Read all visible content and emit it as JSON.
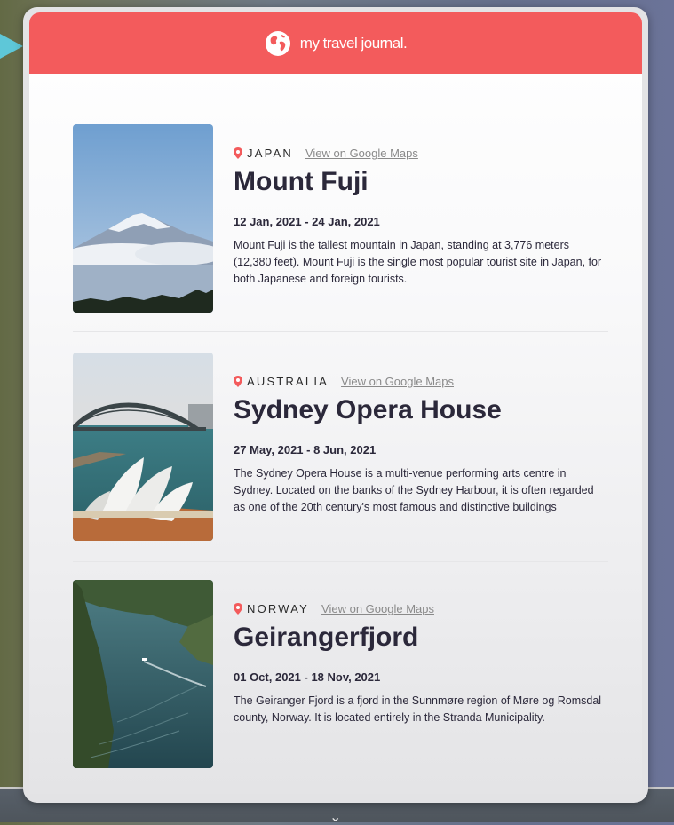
{
  "header": {
    "brand": "my travel journal.",
    "icon": "globe-icon",
    "color": "#F55A5A"
  },
  "entries": [
    {
      "country": "JAPAN",
      "map_link": "View on Google Maps",
      "title": "Mount Fuji",
      "dates": "12 Jan, 2021 - 24 Jan, 2021",
      "description": "Mount Fuji is the tallest mountain in Japan, standing at 3,776 meters (12,380 feet). Mount Fuji is the single most popular tourist site in Japan, for both Japanese and foreign tourists."
    },
    {
      "country": "AUSTRALIA",
      "map_link": "View on Google Maps",
      "title": "Sydney Opera House",
      "dates": "27 May, 2021 - 8 Jun, 2021",
      "description": "The Sydney Opera House is a multi-venue performing arts centre in Sydney. Located on the banks of the Sydney Harbour, it is often regarded as one of the 20th century's most famous and distinctive buildings"
    },
    {
      "country": "NORWAY",
      "map_link": "View on Google Maps",
      "title": "Geirangerfjord",
      "dates": "01 Oct, 2021 - 18 Nov, 2021",
      "description": "The Geiranger Fjord is a fjord in the Sunnmøre region of Møre og Romsdal county, Norway. It is located entirely in the Stranda Municipality."
    }
  ]
}
